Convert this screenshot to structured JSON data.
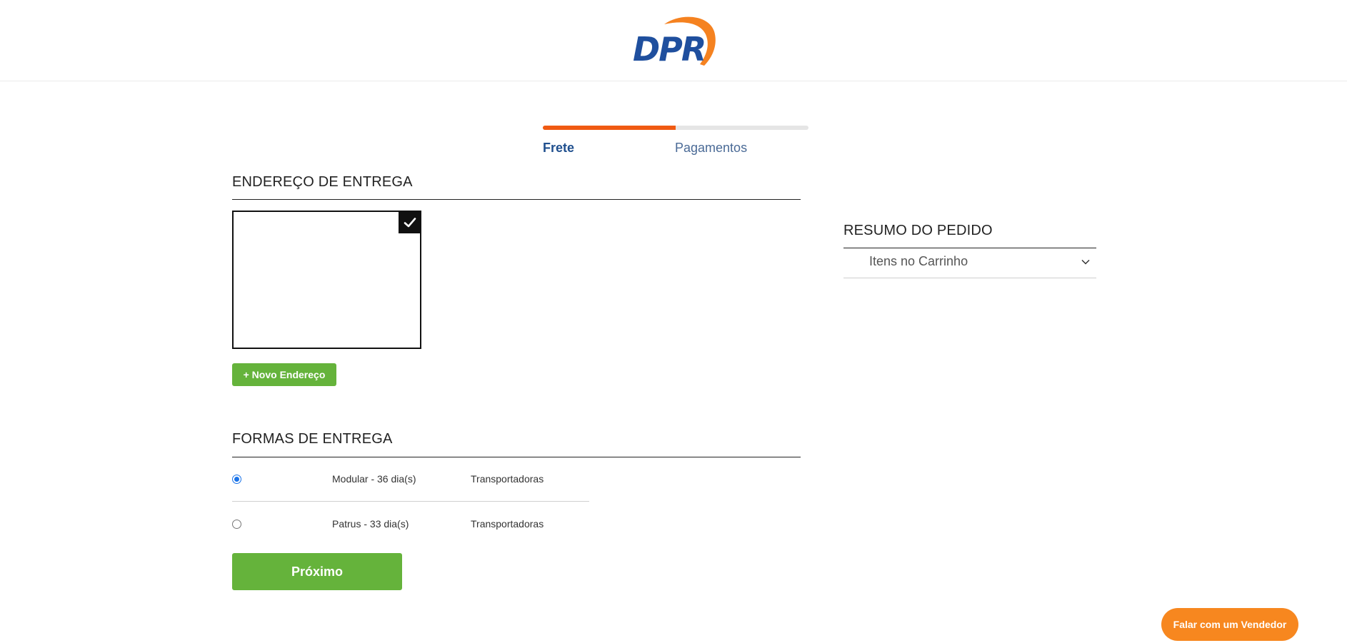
{
  "brand": {
    "logo_text": "DPR",
    "primary_color": "#1f4f9e",
    "accent_color": "#f58220"
  },
  "checkout": {
    "progress_fraction": 0.5,
    "steps": [
      {
        "label": "Frete",
        "active": true
      },
      {
        "label": "Pagamentos",
        "active": false
      }
    ]
  },
  "delivery_address": {
    "title": "ENDEREÇO DE ENTREGA",
    "selected_card": true,
    "new_address_label": "+ Novo Endereço"
  },
  "shipping": {
    "title": "FORMAS DE ENTREGA",
    "options": [
      {
        "name": "Modular - 36 dia(s)",
        "type": "Transportadoras",
        "selected": true
      },
      {
        "name": "Patrus - 33 dia(s)",
        "type": "Transportadoras",
        "selected": false
      }
    ]
  },
  "next_button": {
    "label": "Próximo",
    "color": "#65b33b"
  },
  "order_summary": {
    "title": "RESUMO DO PEDIDO",
    "cart_items_label": "Itens no Carrinho"
  },
  "chat": {
    "label": "Falar com um Vendedor",
    "color": "#f7871f"
  }
}
